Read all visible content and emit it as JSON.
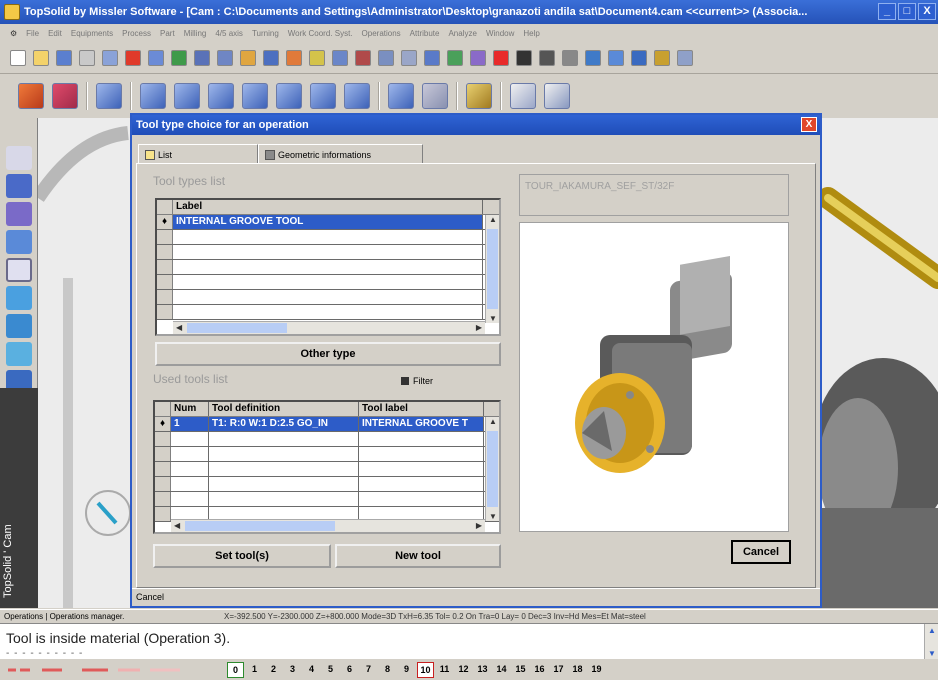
{
  "window": {
    "title": "TopSolid by Missler Software - [Cam : C:\\Documents and Settings\\Administrator\\Desktop\\granazoti andila sat\\Document4.cam  <<current>> (Associa...",
    "minimize": "_",
    "maximize": "□",
    "close": "X"
  },
  "menu": [
    "File",
    "Edit",
    "Equipments",
    "Process",
    "Part",
    "Milling",
    "4/5 axis",
    "Turning",
    "Work Coord. Syst.",
    "Operations",
    "Attribute",
    "Analyze",
    "Window",
    "Help"
  ],
  "sidebar": {
    "label": "TopSolid ' Cam"
  },
  "dialog": {
    "title": "Tool type choice for an operation",
    "close": "X",
    "tabs": [
      {
        "label": "List",
        "icon": "list-icon"
      },
      {
        "label": "Geometric informations",
        "icon": "ruler-icon"
      }
    ],
    "tool_types": {
      "heading": "Tool types list",
      "column": "Label",
      "rows": [
        "INTERNAL GROOVE TOOL"
      ],
      "selected_marker": "♦"
    },
    "other_type_button": "Other type",
    "used_tools": {
      "heading": "Used tools list",
      "filter_label": "Filter",
      "columns": [
        "Num",
        "Tool definition",
        "Tool label"
      ],
      "rows": [
        {
          "num": "1",
          "definition": "T1:  R:0  W:1  D:2.5 GO_IN",
          "label": "INTERNAL GROOVE T"
        }
      ],
      "selected_marker": "♦"
    },
    "set_tool_button": "Set tool(s)",
    "new_tool_button": "New tool",
    "preview": {
      "label": "TOUR_IAKAMURA_SEF_ST/32F"
    },
    "cancel_button": "Cancel",
    "status": "Cancel"
  },
  "status": {
    "operations": "Operations | Operations manager.",
    "coords": "X=-392.500   Y=-2300.000  Z=+800.000  Mode=3D   TxH=6.35   Tol=  0.2   On   Tra=0   Lay=  0   Dec=3   Inv=Hd  Mes=Et  Mat=steel"
  },
  "message": {
    "text": "Tool is inside material (Operation 3).",
    "dashes": "- - - - - - - - - -"
  },
  "layers": {
    "items": [
      "0",
      "1",
      "2",
      "3",
      "4",
      "5",
      "6",
      "7",
      "8",
      "9",
      "10",
      "11",
      "12",
      "13",
      "14",
      "15",
      "16",
      "17",
      "18",
      "19"
    ],
    "current": "0",
    "active": "10"
  },
  "colors": {
    "title_blue": "#2552b8",
    "selection_blue": "#2d5cc8",
    "close_red": "#e0462a",
    "tool_insert_gold": "#e6b22b"
  }
}
